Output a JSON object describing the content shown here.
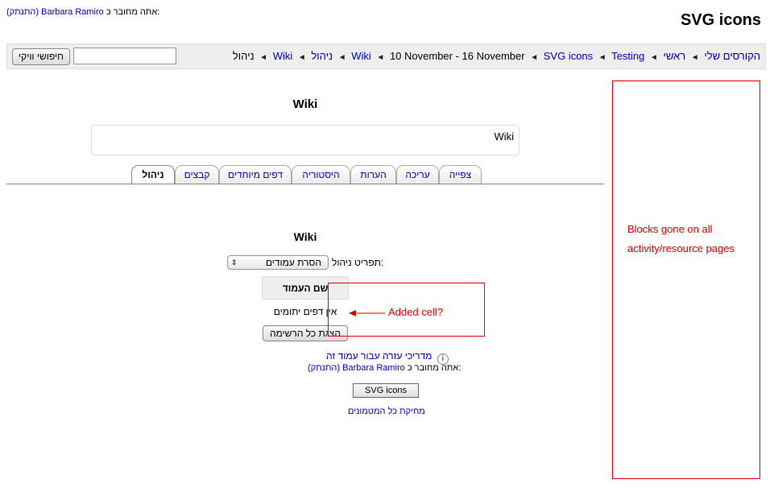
{
  "header": {
    "logged_in_prefix": "אתה מחובר כ:",
    "user_name": "Barbara Ramiro",
    "logout": "(התנתק)",
    "site_title": "SVG icons"
  },
  "navbar": {
    "search_button": "חיפושי וויקי",
    "search_value": "",
    "breadcrumb": [
      "ראשי",
      "הקורסים שלי",
      "Testing",
      "SVG icons",
      "10 November - 16 November",
      "Wiki",
      "ניהול",
      "Wiki",
      "ניהול"
    ],
    "separator": "◄"
  },
  "main": {
    "page_heading": "Wiki",
    "content_text": "Wiki",
    "tabs": [
      "צפייה",
      "עריכה",
      "הערות",
      "היסטוריה",
      "דפים מיוחדים",
      "קבצים",
      "ניהול"
    ],
    "active_tab": "ניהול",
    "sub_heading": "Wiki",
    "menu_label": "תפריט ניהול:",
    "menu_selected": "הסרת עמודים",
    "table_header": "שם העמוד",
    "table_cell": "אין דפים יתומים",
    "show_all_button": "הצגת כל הרשימה"
  },
  "annotations": {
    "added_cell": "Added cell?",
    "blocks_note": "Blocks gone on all activity/resource pages",
    "color": "#e00000"
  },
  "footer": {
    "help_link": "מדריכי עזרה עבור עמוד זה",
    "logged_in_prefix": "אתה מחובר כ:",
    "user_name": "Barbara Ramiro",
    "logout": "(התנתק)",
    "course_button": "SVG icons",
    "purge_link": "מחיקת כל המטמונים"
  }
}
